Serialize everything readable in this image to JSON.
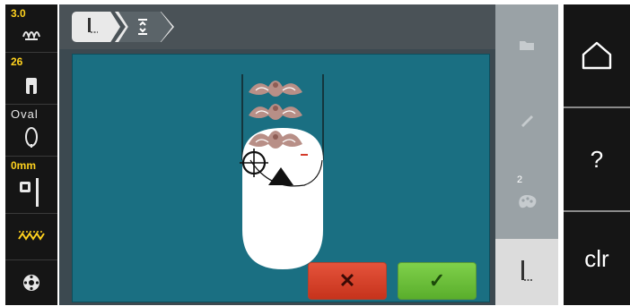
{
  "left_bar": {
    "stitch_length": "3.0",
    "hoop_number": "26",
    "hoop_shape": "Oval",
    "needle_offset": "0mm"
  },
  "right_panel": {
    "badge_count": "2"
  },
  "nav": {
    "help_label": "?",
    "clear_label": "clr"
  },
  "buttons": {
    "cancel_symbol": "✕",
    "confirm_symbol": "✓"
  },
  "colors": {
    "canvas_bg": "#1a6f82",
    "accent_yellow": "#ffd21e",
    "cancel_red": "#d2412a",
    "confirm_green": "#6cc23a"
  },
  "icons": [
    "stitch-length-icon",
    "hoop-icon",
    "oval-hoop-icon",
    "needle-icon",
    "zigzag-icon",
    "bobbin-icon",
    "folder-icon",
    "pencil-icon",
    "palette-icon",
    "presser-foot-icon",
    "home-icon"
  ]
}
